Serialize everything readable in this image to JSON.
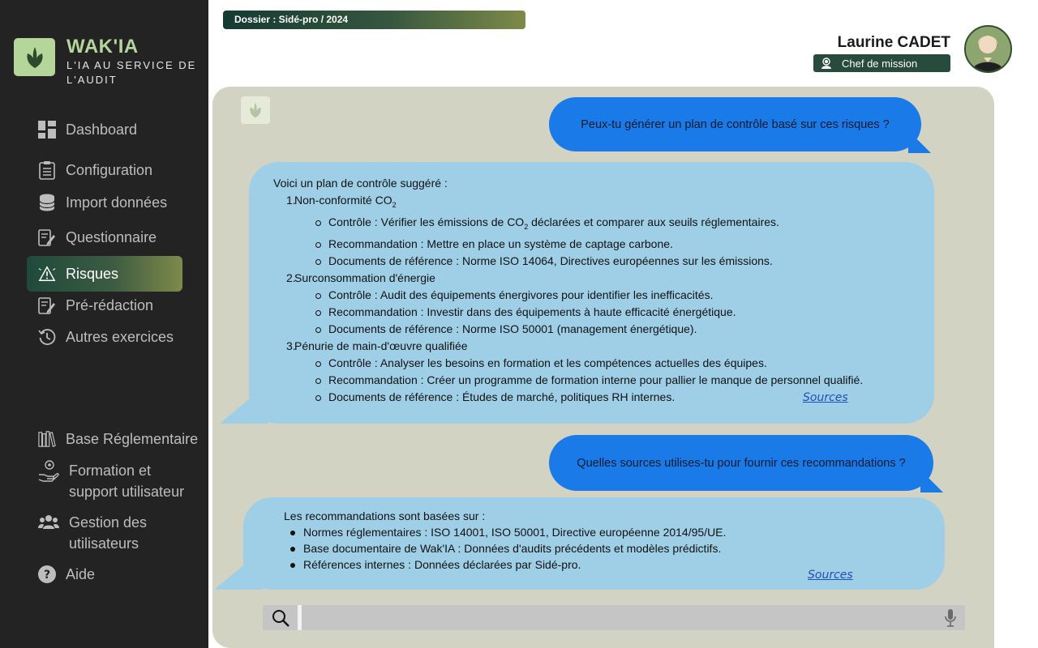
{
  "brand": {
    "name": "WAK'IA",
    "tagline": "L'IA AU SERVICE DE L'AUDIT"
  },
  "nav": {
    "dashboard": "Dashboard",
    "configuration": "Configuration",
    "import": "Import données",
    "questionnaire": "Questionnaire",
    "risques": "Risques",
    "preredaction": "Pré-rédaction",
    "autres": "Autres exercices",
    "base": "Base Réglementaire",
    "formation_l1": "Formation et",
    "formation_l2": "support utilisateur",
    "gestion_l1": "Gestion des",
    "gestion_l2": "utilisateurs",
    "aide": "Aide"
  },
  "header": {
    "dossier": "Dossier : Sidé-pro / 2024",
    "user_name": "Laurine CADET",
    "user_role": "Chef de mission"
  },
  "chat": {
    "q1": "Peux-tu générer un plan de contrôle basé sur ces risques ?",
    "a1": {
      "intro": "Voici un plan de contrôle suggéré :",
      "sections": [
        {
          "num": "1.",
          "title": "Non-conformité CO",
          "title_sub": "2",
          "items": [
            {
              "text": "Contrôle : Vérifier les émissions de CO",
              "sub": "2",
              "after": " déclarées et comparer aux seuils réglementaires."
            },
            {
              "text": "Recommandation : Mettre en place un système de captage carbone."
            },
            {
              "text": "Documents de référence : Norme ISO 14064, Directives européennes sur les émissions."
            }
          ]
        },
        {
          "num": "2.",
          "title": "Surconsommation d'énergie",
          "items": [
            {
              "text": "Contrôle : Audit des équipements énergivores pour identifier les inefficacités."
            },
            {
              "text": "Recommandation : Investir dans des équipements à haute efficacité énergétique."
            },
            {
              "text": "Documents de référence : Norme ISO 50001 (management énergétique)."
            }
          ]
        },
        {
          "num": "3.",
          "title": "Pénurie de main-d'œuvre qualifiée",
          "items": [
            {
              "text": "Contrôle : Analyser les besoins en formation et les compétences actuelles des équipes."
            },
            {
              "text": "Recommandation : Créer un programme de formation interne pour pallier le manque de personnel qualifié."
            },
            {
              "text": "Documents de référence : Études de marché, politiques RH internes."
            }
          ]
        }
      ],
      "sources": "Sources "
    },
    "q2": "Quelles sources utilises-tu pour fournir ces recommandations ?",
    "a2": {
      "intro": "Les recommandations sont basées sur :",
      "items": [
        "Normes réglementaires : ISO 14001, ISO 50001, Directive européenne 2014/95/UE.",
        "Base documentaire de Wak'IA : Données d'audits précédents et modèles prédictifs.",
        "Références internes : Données déclarées par Sidé-pro."
      ],
      "sources": "Sources "
    }
  },
  "search": {
    "value": "",
    "placeholder": ""
  }
}
